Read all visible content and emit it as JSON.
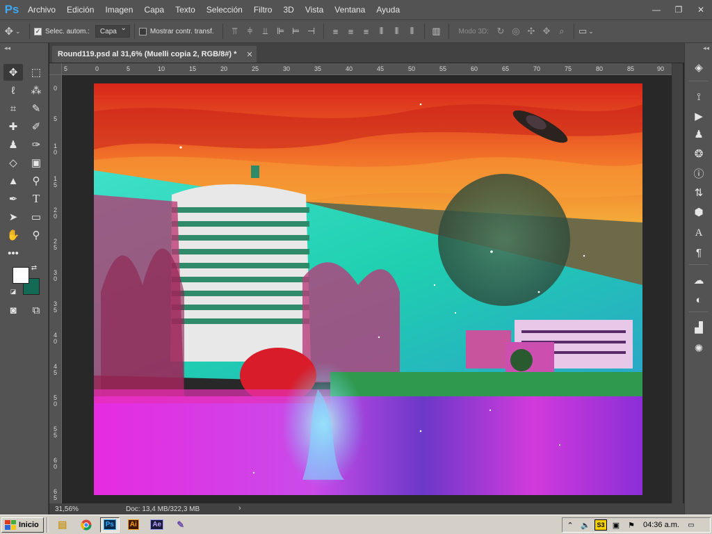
{
  "app": {
    "logo": "Ps"
  },
  "menu": [
    "Archivo",
    "Edición",
    "Imagen",
    "Capa",
    "Texto",
    "Selección",
    "Filtro",
    "3D",
    "Vista",
    "Ventana",
    "Ayuda"
  ],
  "window_controls": {
    "minimize": "—",
    "restore": "❐",
    "close": "✕"
  },
  "options_bar": {
    "auto_select_label": "Selec. autom.:",
    "auto_select_checked": true,
    "auto_select_target": "Capa",
    "show_transform_label": "Mostrar contr. transf.",
    "show_transform_checked": false,
    "mode_3d_label": "Modo 3D:"
  },
  "toolbar": {
    "collapse": "◂◂"
  },
  "document_tab": {
    "title": "Round119.psd al 31,6% (Muelli copia 2, RGB/8#) *",
    "close": "✕"
  },
  "ruler_h": [
    "5",
    "0",
    "5",
    "10",
    "15",
    "20",
    "25",
    "30",
    "35",
    "40",
    "45",
    "50",
    "55",
    "60",
    "65",
    "70",
    "75",
    "80",
    "85",
    "90"
  ],
  "ruler_v": [
    "0",
    "5",
    "1 0",
    "1 5",
    "2 0",
    "2 5",
    "3 0",
    "3 5",
    "4 0",
    "4 5",
    "5 0",
    "5 5",
    "6 0",
    "6 5"
  ],
  "status": {
    "zoom": "31,56%",
    "doc": "Doc: 13,4 MB/322,3 MB",
    "arrow": "›"
  },
  "right_dock": {
    "collapse": "◂◂"
  },
  "taskbar": {
    "start_label": "Inicio",
    "apps": [
      "Ps",
      "Ai",
      "Ae"
    ],
    "clock": "04:36 a.m."
  },
  "colors": {
    "foreground": "#ffffff",
    "background": "#136b55",
    "panel": "#535353",
    "accent": "#3da8f5"
  }
}
